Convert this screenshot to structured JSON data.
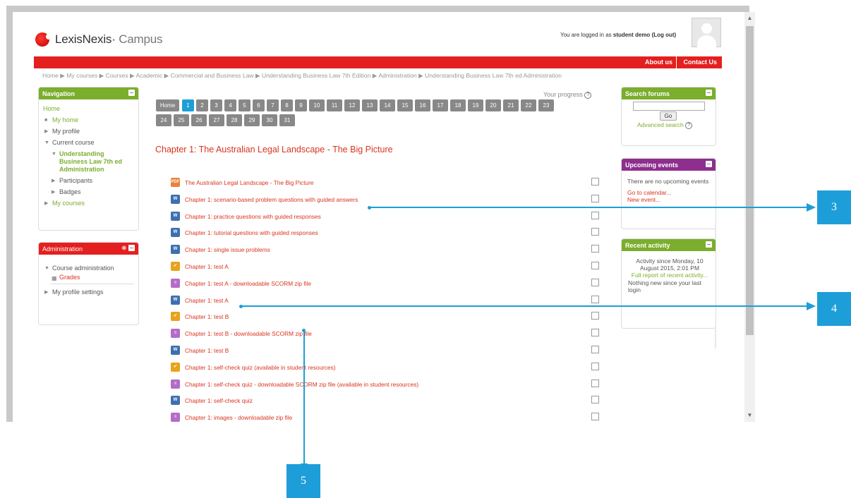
{
  "header": {
    "brand": "LexisNexis",
    "brand_suffix": "Campus",
    "login_prefix": "You are logged in as ",
    "user": "student demo",
    "logout": "(Log out)",
    "about": "About us",
    "contact": "Contact Us"
  },
  "breadcrumb": "Home ▶ My courses ▶ Courses ▶ Academic ▶ Commercial and Business Law ▶ Understanding Business Law 7th Edition ▶ Administration ▶ Understanding Business Law 7th ed Administration",
  "navigation": {
    "title": "Navigation",
    "home": "Home",
    "my_home": "My home",
    "my_profile": "My profile",
    "current_course": "Current course",
    "course_name": "Understanding Business Law 7th ed Administration",
    "participants": "Participants",
    "badges": "Badges",
    "my_courses": "My courses"
  },
  "administration": {
    "title": "Administration",
    "course_admin": "Course administration",
    "grades": "Grades",
    "profile_settings": "My profile settings"
  },
  "main": {
    "progress_label": "Your progress",
    "home_tab": "Home",
    "pages": [
      "1",
      "2",
      "3",
      "4",
      "5",
      "6",
      "7",
      "8",
      "9",
      "10",
      "11",
      "12",
      "13",
      "14",
      "15",
      "16",
      "17",
      "18",
      "19",
      "20",
      "21",
      "22",
      "23",
      "24",
      "25",
      "26",
      "27",
      "28",
      "29",
      "30",
      "31"
    ],
    "active_page": "1",
    "chapter_title": "Chapter 1: The Australian Legal Landscape - The Big Picture",
    "activities": [
      {
        "label": "The Australian Legal Landscape - The Big Picture",
        "icon": "pdf-icon"
      },
      {
        "label": "Chapter 1: scenario-based problem questions with guided answers",
        "icon": "word-doc-icon"
      },
      {
        "label": "Chapter 1: practice questions with guided responses",
        "icon": "word-doc-icon"
      },
      {
        "label": "Chapter 1: tutorial questions with guided responses",
        "icon": "word-doc-icon"
      },
      {
        "label": "Chapter 1: single issue problems",
        "icon": "word-doc-icon"
      },
      {
        "label": "Chapter 1: test A",
        "icon": "quiz-icon"
      },
      {
        "label": "Chapter 1: test A - downloadable SCORM zip file",
        "icon": "scorm-package-icon"
      },
      {
        "label": "Chapter 1: test A",
        "icon": "word-doc-icon"
      },
      {
        "label": "Chapter 1: test B",
        "icon": "quiz-icon"
      },
      {
        "label": "Chapter 1: test B - downloadable SCORM zip file",
        "icon": "scorm-package-icon"
      },
      {
        "label": "Chapter 1: test B",
        "icon": "word-doc-icon"
      },
      {
        "label": "Chapter 1: self-check quiz (available in student resources)",
        "icon": "quiz-icon"
      },
      {
        "label": "Chapter 1: self-check quiz - downloadable SCORM zip file (available in student resources)",
        "icon": "scorm-package-icon"
      },
      {
        "label": "Chapter 1: self-check quiz",
        "icon": "word-doc-icon"
      },
      {
        "label": "Chapter 1: images - downloadable zip file",
        "icon": "scorm-package-icon"
      }
    ]
  },
  "search_forums": {
    "title": "Search forums",
    "go": "Go",
    "advanced": "Advanced search"
  },
  "upcoming_events": {
    "title": "Upcoming events",
    "none": "There are no upcoming events",
    "calendar": "Go to calendar...",
    "new_event": "New event..."
  },
  "recent_activity": {
    "title": "Recent activity",
    "since": "Activity since Monday, 10 August 2015, 2:01 PM",
    "full_report": "Full report of recent activity...",
    "nothing_new": "Nothing new since your last login"
  },
  "callouts": [
    "3",
    "4",
    "5"
  ],
  "colors": {
    "brand_red": "#e41f1f",
    "link_green": "#7aae2c",
    "activity_red": "#d9341f",
    "callout_blue": "#1e9ed8",
    "events_purple": "#8e2e8e"
  }
}
